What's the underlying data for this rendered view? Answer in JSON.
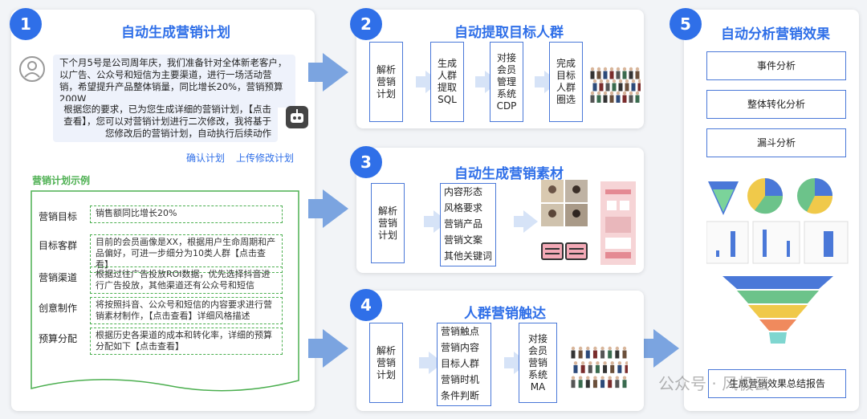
{
  "colors": {
    "accent": "#2f6fe8",
    "arrow": "#7ba4e0",
    "green": "#4caf50"
  },
  "panel1": {
    "badge": "1",
    "title": "自动生成营销计划",
    "user_msg": "下个月5号是公司周年庆，我们准备针对全体新老客户，以广告、公众号和短信为主要渠道，进行一场活动营销，希望提升产品整体销量，同比增长20%，营销预算200W",
    "bot_msg": "根据您的要求，已为您生成详细的营销计划，【点击查看】，您可以对营销计划进行二次修改，我将基于您修改后的营销计划，自动执行后续动作",
    "confirm_link": "确认计划",
    "upload_link": "上传修改计划",
    "example_title": "营销计划示例",
    "rows": [
      {
        "label": "营销目标",
        "text": "销售额同比增长20%"
      },
      {
        "label": "目标客群",
        "text": "目前的会员画像是XX，根据用户生命周期和产品偏好，可进一步细分为10类人群【点击查看】"
      },
      {
        "label": "营销渠道",
        "text": "根据过往广告投放ROI数据，优先选择抖音进行广告投放，其他渠道还有公众号和短信"
      },
      {
        "label": "创意制作",
        "text": "将按照抖音、公众号和短信的内容要求进行营销素材制作，【点击查看】详细风格描述"
      },
      {
        "label": "预算分配",
        "text": "根据历史各渠道的成本和转化率，详细的预算分配如下【点击查看】"
      }
    ]
  },
  "panel2": {
    "badge": "2",
    "title": "自动提取目标人群",
    "steps": [
      "解析\n营销\n计划",
      "生成\n人群\n提取\nSQL",
      "对接\n会员\n管理\n系统\nCDP",
      "完成\n目标\n人群\n圈选"
    ]
  },
  "panel3": {
    "badge": "3",
    "title": "自动生成营销素材",
    "step1": "解析\n营销\n计划",
    "items": [
      "内容形态",
      "风格要求",
      "营销产品",
      "营销文案",
      "其他关键词"
    ]
  },
  "panel4": {
    "badge": "4",
    "title": "人群营销触达",
    "step1": "解析\n营销\n计划",
    "items": [
      "营销触点",
      "营销内容",
      "目标人群",
      "营销时机",
      "条件判断"
    ],
    "step3": "对接\n会员\n营销\n系统\nMA"
  },
  "panel5": {
    "badge": "5",
    "title": "自动分析营销效果",
    "analyses": [
      "事件分析",
      "整体转化分析",
      "漏斗分析"
    ],
    "report": "生成营销效果总结报告"
  },
  "watermark": "公众号 · 风极云"
}
